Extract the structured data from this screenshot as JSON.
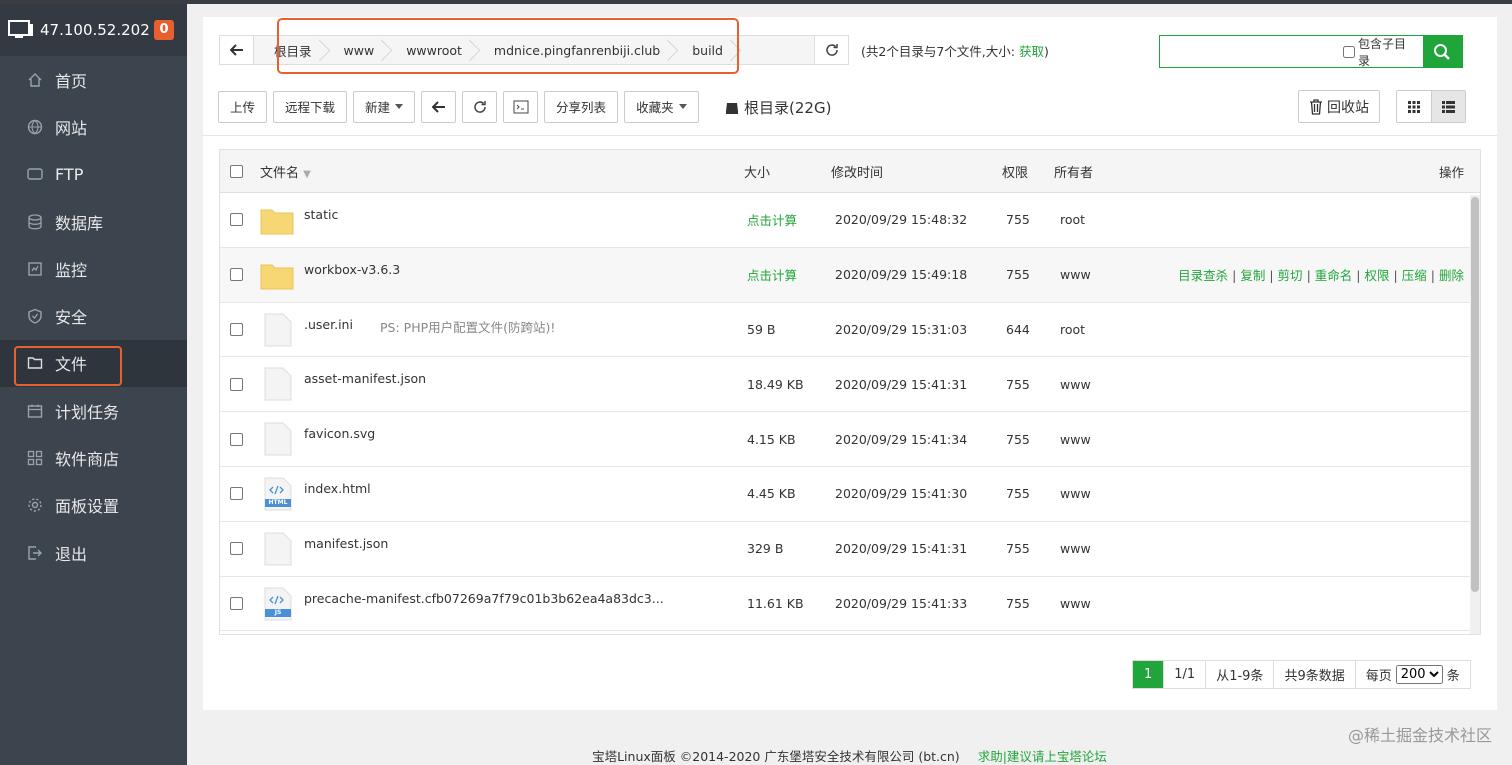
{
  "sidebar": {
    "ip": "47.100.52.202",
    "badge": "0",
    "items": [
      {
        "label": "首页",
        "icon": "home-icon"
      },
      {
        "label": "网站",
        "icon": "globe-icon"
      },
      {
        "label": "FTP",
        "icon": "ftp-icon"
      },
      {
        "label": "数据库",
        "icon": "database-icon"
      },
      {
        "label": "监控",
        "icon": "monitor-icon"
      },
      {
        "label": "安全",
        "icon": "shield-icon"
      },
      {
        "label": "文件",
        "icon": "folder-icon"
      },
      {
        "label": "计划任务",
        "icon": "calendar-icon"
      },
      {
        "label": "软件商店",
        "icon": "apps-icon"
      },
      {
        "label": "面板设置",
        "icon": "gear-icon"
      },
      {
        "label": "退出",
        "icon": "logout-icon"
      }
    ]
  },
  "breadcrumbs": [
    "根目录",
    "www",
    "wwwroot",
    "mdnice.pingfanrenbiji.club",
    "build"
  ],
  "dirinfo": {
    "text": "(共2个目录与7个文件,大小: ",
    "link": "获取",
    "end": ")"
  },
  "search": {
    "placeholder": "",
    "subdir_label": "包含子目录"
  },
  "toolbar": {
    "upload": "上传",
    "remote_download": "远程下载",
    "new": "新建",
    "share_list": "分享列表",
    "favorites": "收藏夹"
  },
  "root_disk": "根目录(22G)",
  "recycle": "回收站",
  "columns": {
    "name": "文件名",
    "size": "大小",
    "mtime": "修改时间",
    "perm": "权限",
    "owner": "所有者",
    "ops": "操作"
  },
  "rows": [
    {
      "name": "static",
      "type": "folder",
      "size": "点击计算",
      "mtime": "2020/09/29 15:48:32",
      "perm": "755",
      "owner": "root"
    },
    {
      "name": "workbox-v3.6.3",
      "type": "folder",
      "size": "点击计算",
      "mtime": "2020/09/29 15:49:18",
      "perm": "755",
      "owner": "www"
    },
    {
      "name": ".user.ini",
      "type": "file",
      "note": "PS: PHP用户配置文件(防跨站)!",
      "size": "59 B",
      "mtime": "2020/09/29 15:31:03",
      "perm": "644",
      "owner": "root"
    },
    {
      "name": "asset-manifest.json",
      "type": "file",
      "size": "18.49 KB",
      "mtime": "2020/09/29 15:41:31",
      "perm": "755",
      "owner": "www"
    },
    {
      "name": "favicon.svg",
      "type": "file",
      "size": "4.15 KB",
      "mtime": "2020/09/29 15:41:34",
      "perm": "755",
      "owner": "www"
    },
    {
      "name": "index.html",
      "type": "html",
      "size": "4.45 KB",
      "mtime": "2020/09/29 15:41:30",
      "perm": "755",
      "owner": "www"
    },
    {
      "name": "manifest.json",
      "type": "file",
      "size": "329 B",
      "mtime": "2020/09/29 15:41:31",
      "perm": "755",
      "owner": "www"
    },
    {
      "name": "precache-manifest.cfb07269a7f79c01b3b62ea4a83dc3...",
      "type": "js",
      "size": "11.61 KB",
      "mtime": "2020/09/29 15:41:33",
      "perm": "755",
      "owner": "www"
    }
  ],
  "row_ops": [
    "目录查杀",
    "复制",
    "剪切",
    "重命名",
    "权限",
    "压缩",
    "删除"
  ],
  "icon_badges": {
    "html": "HTML",
    "js": "JS"
  },
  "pager": {
    "current": "1",
    "pages": "1/1",
    "range": "从1-9条",
    "total": "共9条数据",
    "per_page_label": "每页",
    "per_page": "200",
    "unit": "条"
  },
  "footer": {
    "copyright": "宝塔Linux面板 ©2014-2020 广东堡塔安全技术有限公司 (bt.cn)",
    "link": "求助|建议请上宝塔论坛"
  },
  "watermark": "@稀土掘金技术社区",
  "colors": {
    "accent": "#20a53a",
    "highlight": "#e8602d",
    "sidebar": "#3c444d"
  }
}
